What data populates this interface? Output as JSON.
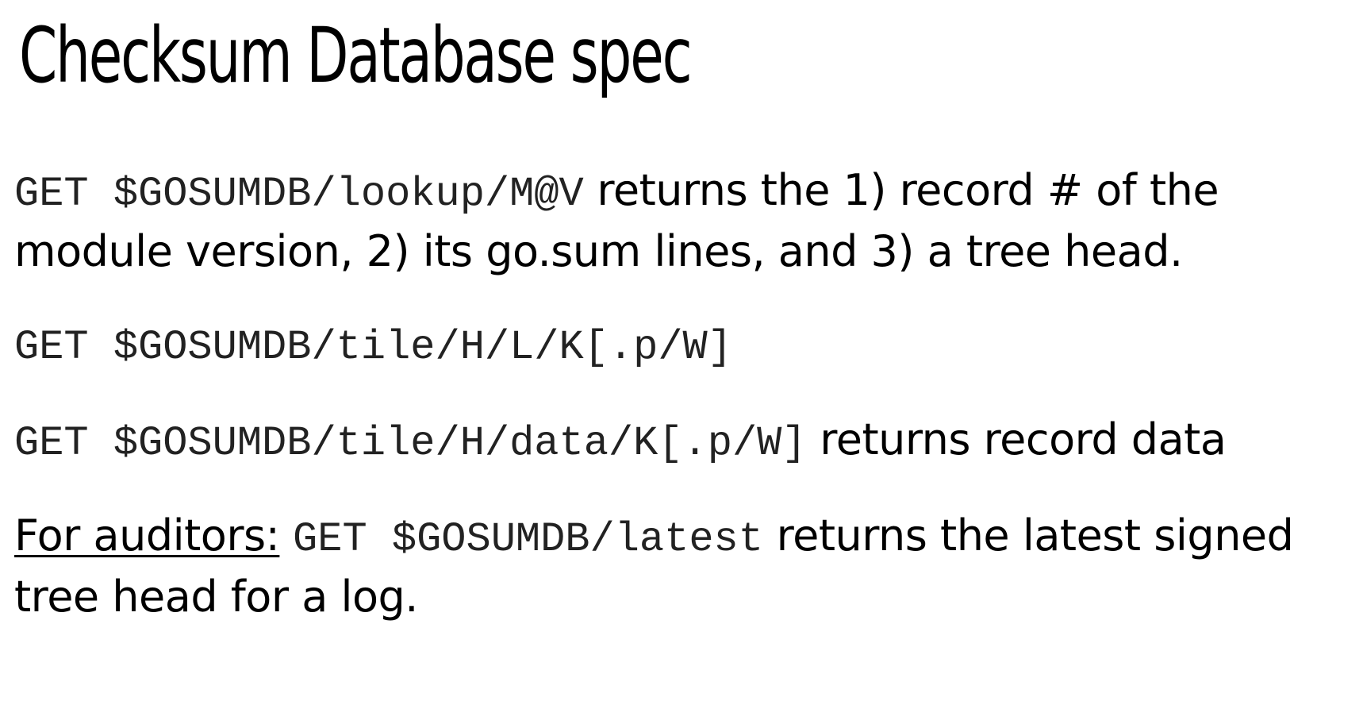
{
  "slide": {
    "title": "Checksum Database spec",
    "items": [
      {
        "code": "GET $GOSUMDB/lookup/M@V",
        "text": " returns the 1) record # of the module version, 2) its go.sum lines, and 3) a tree head."
      },
      {
        "code": "GET $GOSUMDB/tile/H/L/K[.p/W]",
        "text": ""
      },
      {
        "code": "GET $GOSUMDB/tile/H/data/K[.p/W]",
        "text": " returns record data"
      },
      {
        "prefix": "For auditors:",
        "code": "GET $GOSUMDB/latest",
        "text": " returns the latest signed tree head for a log."
      }
    ]
  }
}
